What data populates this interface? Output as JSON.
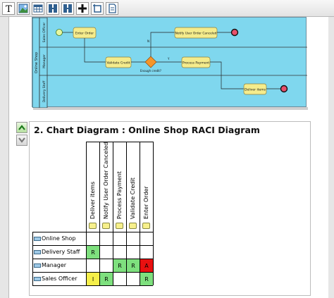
{
  "toolbar": {
    "buttons": [
      {
        "name": "text-icon",
        "glyph": "T"
      },
      {
        "name": "image-icon"
      },
      {
        "name": "table-icon"
      },
      {
        "name": "page-break-icon"
      },
      {
        "name": "page-break-alt-icon"
      },
      {
        "name": "plus-icon"
      },
      {
        "name": "crop-icon"
      },
      {
        "name": "page-icon"
      }
    ]
  },
  "bpd": {
    "lanes": [
      "Sales Officer",
      "Manager",
      "Delivery Staff"
    ],
    "pool": "Online Shop",
    "tasks": {
      "enter_order": "Enter Order",
      "notify": "Notify User Order Canceled",
      "validate": "Validate Credit",
      "process": "Process Payment",
      "deliver": "Deliver items"
    },
    "gateway_label": "Enough credit?",
    "flow_n": "N",
    "flow_y": "Y"
  },
  "section": {
    "title": "2. Chart Diagram : Online Shop RACI Diagram"
  },
  "raci": {
    "columns": [
      "Deliver items",
      "Notify User Order Canceled",
      "Process Payment",
      "Validate Credit",
      "Enter Order"
    ],
    "rows": [
      {
        "role": "Online Shop",
        "cells": [
          "",
          "",
          "",
          "",
          ""
        ]
      },
      {
        "role": "Delivery Staff",
        "cells": [
          "R",
          "",
          "",
          "",
          ""
        ]
      },
      {
        "role": "Manager",
        "cells": [
          "",
          "",
          "R",
          "R",
          "A"
        ]
      },
      {
        "role": "Sales Officer",
        "cells": [
          "I",
          "R",
          "",
          "",
          "R"
        ]
      }
    ],
    "colors": {
      "R": "#7ee07e",
      "A": "#e81010",
      "I": "#f5ef4a",
      "": "#ffffff"
    }
  }
}
